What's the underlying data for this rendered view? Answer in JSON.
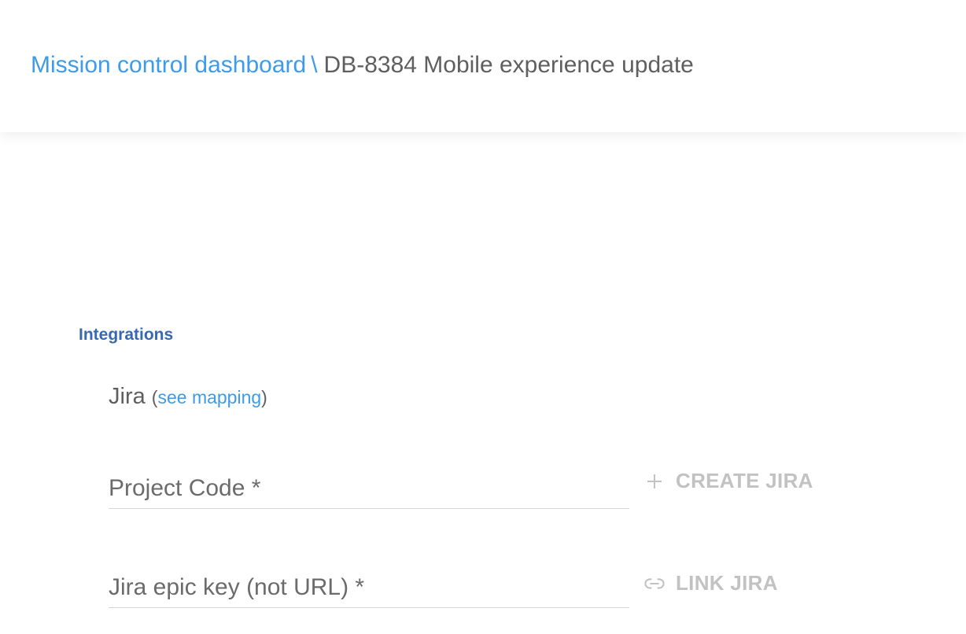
{
  "breadcrumb": {
    "parent": "Mission control dashboard",
    "separator": "\\",
    "current": "DB-8384 Mobile experience update"
  },
  "integrations": {
    "title": "Integrations",
    "jira": {
      "label": "Jira",
      "open_paren": "(",
      "mapping_link": "see mapping",
      "close_paren": ")"
    },
    "project_code": {
      "placeholder": "Project Code *",
      "value": ""
    },
    "create_jira": {
      "label": "CREATE JIRA",
      "icon": "plus-icon"
    },
    "epic_key": {
      "placeholder": "Jira epic key (not URL) *",
      "value": ""
    },
    "link_jira": {
      "label": "LINK JIRA",
      "icon": "link-icon"
    }
  },
  "colors": {
    "link": "#3d9be9",
    "section_title": "#3768b0",
    "text": "#5f5f5f",
    "disabled": "#c2c2c2"
  }
}
